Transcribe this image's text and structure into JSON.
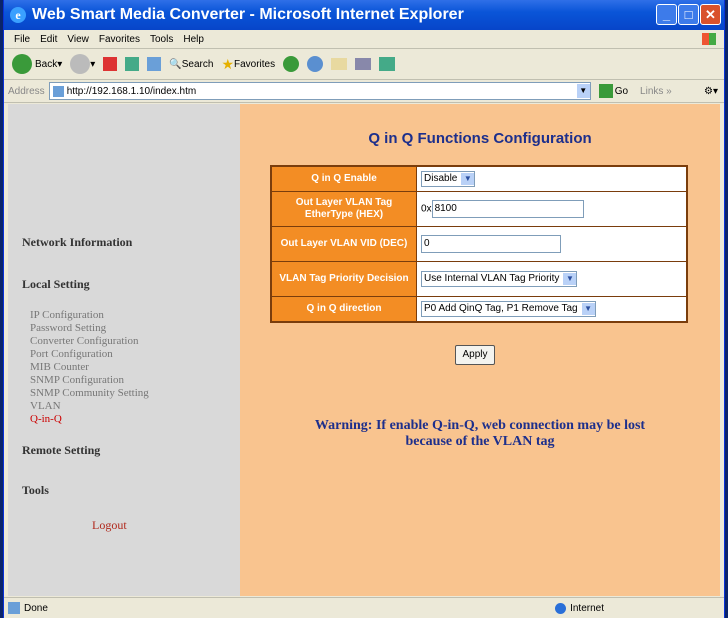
{
  "window": {
    "title": "Web Smart Media Converter - Microsoft Internet Explorer"
  },
  "menu": [
    "File",
    "Edit",
    "View",
    "Favorites",
    "Tools",
    "Help"
  ],
  "toolbar": {
    "back": "Back",
    "search": "Search",
    "favorites": "Favorites"
  },
  "address": {
    "label": "Address",
    "url": "http://192.168.1.10/index.htm",
    "go": "Go",
    "links": "Links"
  },
  "sidebar": {
    "network_info": "Network Information",
    "local_setting": "Local Setting",
    "items": [
      "IP Configuration",
      "Password Setting",
      "Converter Configuration",
      "Port Configuration",
      "MIB Counter",
      "SNMP Configuration",
      "SNMP Community Setting",
      "VLAN",
      "Q-in-Q"
    ],
    "remote_setting": "Remote Setting",
    "tools": "Tools",
    "logout": "Logout"
  },
  "main": {
    "heading": "Q in Q Functions Configuration",
    "rows": [
      {
        "label": "Q in Q Enable",
        "value": "Disable"
      },
      {
        "label": "Out Layer VLAN Tag EtherType (HEX)",
        "prefix": "0x",
        "value": "8100"
      },
      {
        "label": "Out Layer VLAN VID (DEC)",
        "value": "0"
      },
      {
        "label": "VLAN Tag Priority Decision",
        "value": "Use Internal VLAN Tag Priority"
      },
      {
        "label": "Q in Q direction",
        "value": "P0 Add QinQ Tag, P1 Remove Tag"
      }
    ],
    "apply": "Apply",
    "warning_line1": "Warning: If enable Q-in-Q, web connection may be lost",
    "warning_line2": "because of the VLAN tag"
  },
  "status": {
    "left": "Done",
    "zone": "Internet"
  },
  "colors": {
    "sidebar_active": "#cc0000",
    "label_bg": "#f38d24",
    "panel_bg": "#f9c48f",
    "heading": "#1d2f8c"
  }
}
